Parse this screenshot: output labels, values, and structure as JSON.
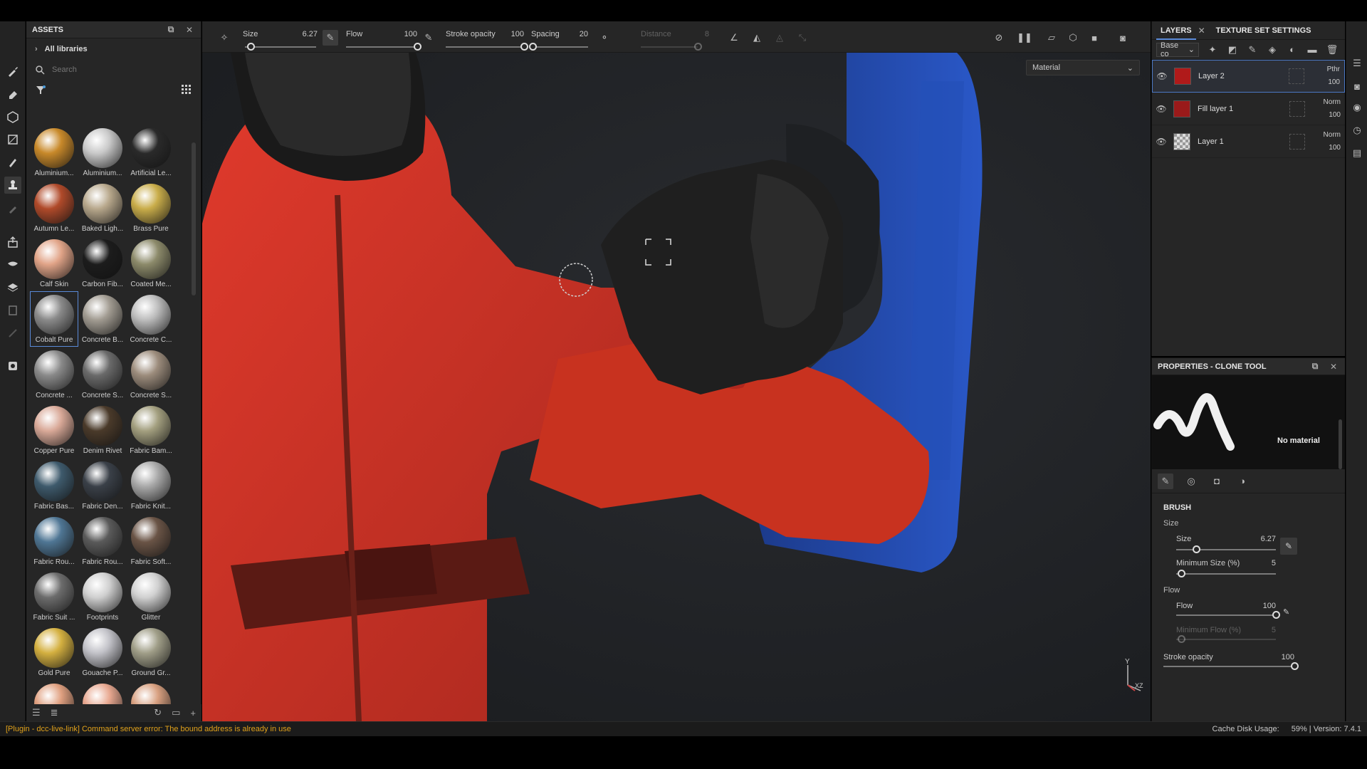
{
  "assets": {
    "title": "ASSETS",
    "library": "All libraries",
    "search_placeholder": "Search",
    "items": [
      {
        "label": "Aluminium...",
        "color": "#c8892a"
      },
      {
        "label": "Aluminium...",
        "color": "#c9c9c9"
      },
      {
        "label": "Artificial Le...",
        "color": "#2a2a2a"
      },
      {
        "label": "Autumn Le...",
        "color": "#b04a2a"
      },
      {
        "label": "Baked Ligh...",
        "color": "#b8a88c"
      },
      {
        "label": "Brass Pure",
        "color": "#c9ad4a"
      },
      {
        "label": "Calf Skin",
        "color": "#e1a488"
      },
      {
        "label": "Carbon Fib...",
        "color": "#1c1c1c"
      },
      {
        "label": "Coated Me...",
        "color": "#8c8a6a"
      },
      {
        "label": "Cobalt Pure",
        "color": "#8a8a8a"
      },
      {
        "label": "Concrete B...",
        "color": "#a29c92"
      },
      {
        "label": "Concrete C...",
        "color": "#bdbdbd"
      },
      {
        "label": "Concrete ...",
        "color": "#8a8a8a"
      },
      {
        "label": "Concrete S...",
        "color": "#6a6a6a"
      },
      {
        "label": "Concrete S...",
        "color": "#9c8c7c"
      },
      {
        "label": "Copper Pure",
        "color": "#d9a998"
      },
      {
        "label": "Denim Rivet",
        "color": "#4a3a2a"
      },
      {
        "label": "Fabric Bam...",
        "color": "#a39f7f"
      },
      {
        "label": "Fabric Bas...",
        "color": "#3e5a6c"
      },
      {
        "label": "Fabric Den...",
        "color": "#3a4048"
      },
      {
        "label": "Fabric Knit...",
        "color": "#a9a9a9"
      },
      {
        "label": "Fabric Rou...",
        "color": "#4f7694"
      },
      {
        "label": "Fabric Rou...",
        "color": "#5a5a5a"
      },
      {
        "label": "Fabric Soft...",
        "color": "#6a5446"
      },
      {
        "label": "Fabric Suit ...",
        "color": "#6c6c6c"
      },
      {
        "label": "Footprints",
        "color": "#cfcfcf"
      },
      {
        "label": "Glitter",
        "color": "#d0d0d0"
      },
      {
        "label": "Gold Pure",
        "color": "#d4b040"
      },
      {
        "label": "Gouache P...",
        "color": "#c2c2c8"
      },
      {
        "label": "Ground Gr...",
        "color": "#a09e88"
      },
      {
        "label": "",
        "color": "#e0a080"
      },
      {
        "label": "",
        "color": "#e8a890"
      },
      {
        "label": "",
        "color": "#d8a080"
      }
    ]
  },
  "toolbar": {
    "size_label": "Size",
    "size_value": "6.27",
    "size_frac": 0.08,
    "flow_label": "Flow",
    "flow_value": "100",
    "flow_frac": 1.0,
    "stroke_label": "Stroke opacity",
    "stroke_value": "100",
    "stroke_frac": 1.0,
    "spacing_label": "Spacing",
    "spacing_value": "20",
    "spacing_frac": 0.02,
    "distance_label": "Distance",
    "distance_value": "8",
    "distance_frac": 1.0
  },
  "viewport": {
    "channel": "Material"
  },
  "layers": {
    "tab_layers": "LAYERS",
    "tab_texture": "TEXTURE SET SETTINGS",
    "channel": "Base co",
    "items": [
      {
        "name": "Layer 2",
        "blend": "Pthr",
        "opacity": "100",
        "thumb": "#b01a1a",
        "selected": true
      },
      {
        "name": "Fill layer 1",
        "blend": "Norm",
        "opacity": "100",
        "thumb": "#9a1a1a",
        "selected": false
      },
      {
        "name": "Layer 1",
        "blend": "Norm",
        "opacity": "100",
        "thumb": "checker",
        "selected": false
      }
    ]
  },
  "properties": {
    "title": "PROPERTIES - CLONE TOOL",
    "no_material": "No material",
    "brush_title": "BRUSH",
    "size_group": "Size",
    "size_label": "Size",
    "size_value": "6.27",
    "size_frac": 0.2,
    "minsize_label": "Minimum Size (%)",
    "minsize_value": "5",
    "minsize_frac": 0.05,
    "flow_group": "Flow",
    "flow_label": "Flow",
    "flow_value": "100",
    "flow_frac": 1.0,
    "minflow_label": "Minimum Flow (%)",
    "minflow_value": "5",
    "minflow_frac": 0.05,
    "stroke_label": "Stroke opacity",
    "stroke_value": "100",
    "stroke_frac": 1.0
  },
  "status": {
    "message": "[Plugin - dcc-live-link] Command server error: The bound address is already in use",
    "cache": "Cache Disk Usage:",
    "usage": "59% | Version: 7.4.1"
  }
}
